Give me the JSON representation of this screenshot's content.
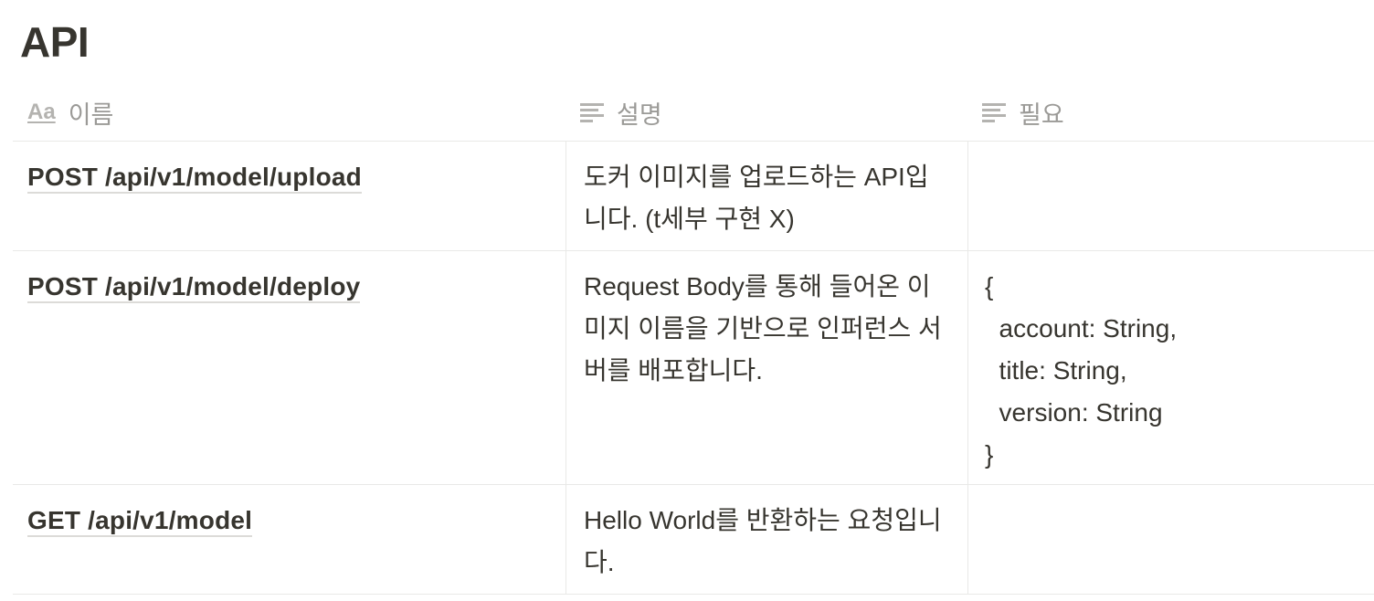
{
  "page": {
    "title": "API"
  },
  "table": {
    "columns": [
      {
        "label": "이름",
        "icon": "title-property-icon"
      },
      {
        "label": "설명",
        "icon": "text-property-icon"
      },
      {
        "label": "필요",
        "icon": "text-property-icon"
      }
    ],
    "title_icon_text": "Aa",
    "rows": [
      {
        "name": "POST /api/v1/model/upload",
        "description": "도커 이미지를 업로드하는 API입니다. (t세부 구현 X)",
        "required": ""
      },
      {
        "name": "POST /api/v1/model/deploy",
        "description": "Request Body를 통해 들어온 이미지 이름을 기반으로 인퍼런스 서버를 배포합니다.",
        "required": "{\n  account: String,\n  title: String,\n  version: String\n}"
      },
      {
        "name": "GET /api/v1/model",
        "description": "Hello World를 반환하는 요청입니다.",
        "required": ""
      }
    ]
  },
  "colors": {
    "text": "#37352f",
    "muted": "#9b9a97",
    "border": "#e9e9e7"
  }
}
